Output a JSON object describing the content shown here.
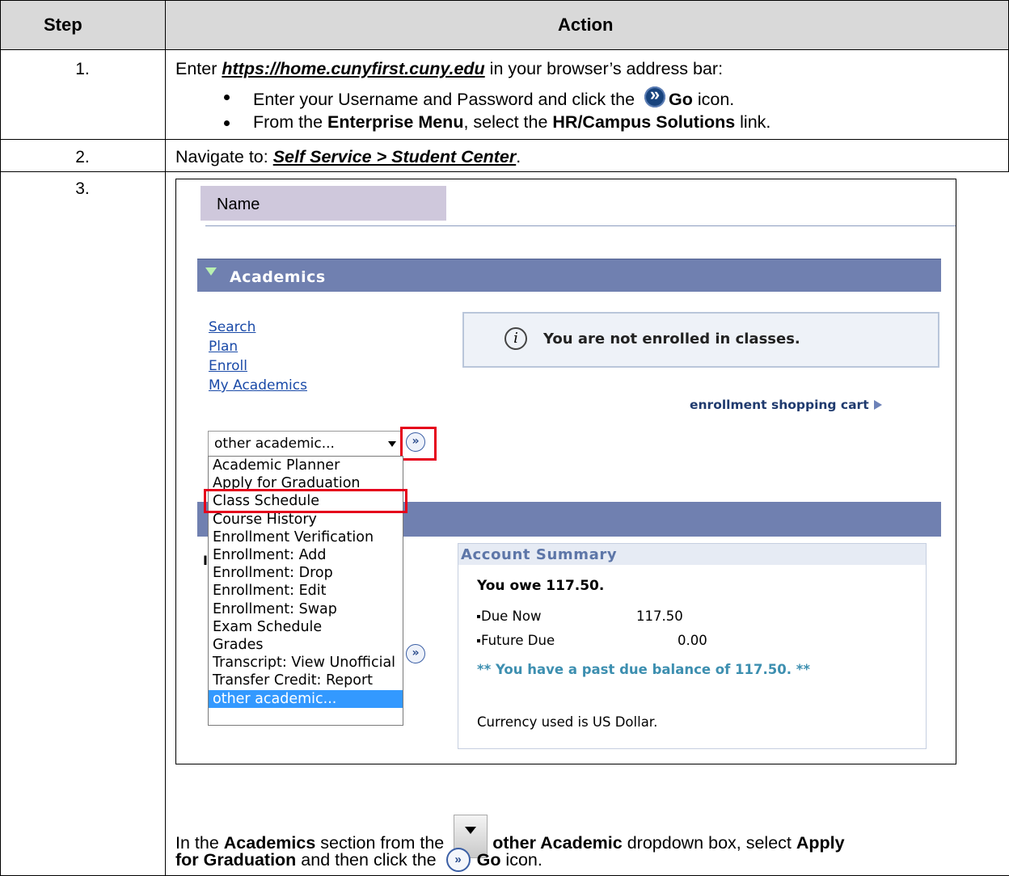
{
  "header": {
    "step": "Step",
    "action": "Action"
  },
  "rows": [
    {
      "step": "1.",
      "line1_pre": "Enter ",
      "url": "https://home.cunyfirst.cuny.edu",
      "line1_post": " in your browser’s address bar:",
      "bullet1_pre": "Enter your Username and Password and click the ",
      "bullet1_go": "Go",
      "bullet1_post": " icon.",
      "bullet2_pre": "From the ",
      "bullet2_menu": "Enterprise Menu",
      "bullet2_mid": ", select the ",
      "bullet2_link": "HR/Campus Solutions",
      "bullet2_post": " link."
    },
    {
      "step": "2.",
      "pre": "Navigate to:  ",
      "path": "Self Service > Student Center",
      "post": "."
    },
    {
      "step": "3.",
      "instr_pre": "In the ",
      "instr_academics": "Academics",
      "instr_mid1": " section from the ",
      "instr_other": "other Academic",
      "instr_mid2": " dropdown box, select ",
      "instr_apply": "Apply",
      "instr_apply2": "for Graduation",
      "instr_mid3": " and then click the ",
      "instr_go": "Go",
      "instr_post": " icon."
    }
  ],
  "screenshot": {
    "name_label": "Name",
    "section_title": "Academics",
    "links": [
      "Search",
      "Plan",
      "Enroll",
      "My Academics"
    ],
    "info_message": "You are not enrolled in classes.",
    "cart_link": "enrollment shopping cart",
    "select_value": "other academic...",
    "dropdown_options": [
      "Academic Planner",
      "Apply for Graduation",
      "Class Schedule",
      "Course History",
      "Enrollment Verification",
      "Enrollment: Add",
      "Enrollment: Drop",
      "Enrollment: Edit",
      "Enrollment: Swap",
      "Exam Schedule",
      "Grades",
      "Transcript: View Unofficial",
      "Transfer Credit: Report",
      "other academic..."
    ],
    "account": {
      "title": "Account Summary",
      "owe": "You owe 117.50.",
      "due_now_label": "Due Now",
      "due_now_value": "117.50",
      "future_due_label": "Future Due",
      "future_due_value": "0.00",
      "past_due": "** You have a past due balance of 117.50. **",
      "currency": "Currency used is US Dollar."
    }
  },
  "colors": {
    "header_bg": "#d9d9d9",
    "section_bar": "#7080b0",
    "highlight": "#e5001b",
    "selected": "#3399ff"
  }
}
